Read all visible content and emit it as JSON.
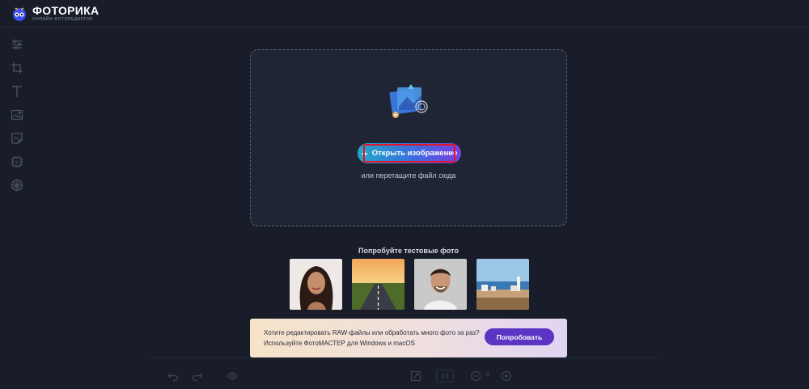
{
  "header": {
    "logo_title": "ФОТОРИКА",
    "logo_subtitle": "ОНЛАЙН-ФОТОРЕДАКТОР"
  },
  "sidebar": {
    "tools": [
      {
        "name": "adjustments-icon"
      },
      {
        "name": "crop-icon"
      },
      {
        "name": "text-icon"
      },
      {
        "name": "image-icon"
      },
      {
        "name": "sticker-icon"
      },
      {
        "name": "ai-icon"
      },
      {
        "name": "effects-icon"
      }
    ]
  },
  "dropzone": {
    "open_button_label": "Открыть изображение",
    "hint": "или перетащите файл сюда"
  },
  "samples": {
    "title": "Попробуйте тестовые фото",
    "items": [
      "woman-portrait",
      "road-sunset",
      "man-portrait",
      "seaside-town"
    ]
  },
  "promo": {
    "line1": "Хотите редактировать RAW-файлы или обработать много фото за раз?",
    "line2": "Используйте ФотоМАСТЕР для Windows и macOS",
    "button_label": "Попробовать"
  },
  "bottom_bar": {
    "ratio_label": "1:1",
    "zoom_value": "0"
  },
  "colors": {
    "background": "#181d29",
    "dropzone": "#1f2535",
    "accent_start": "#1fa9c9",
    "accent_end": "#7a3fe2",
    "promo_button": "#5b34c3"
  }
}
